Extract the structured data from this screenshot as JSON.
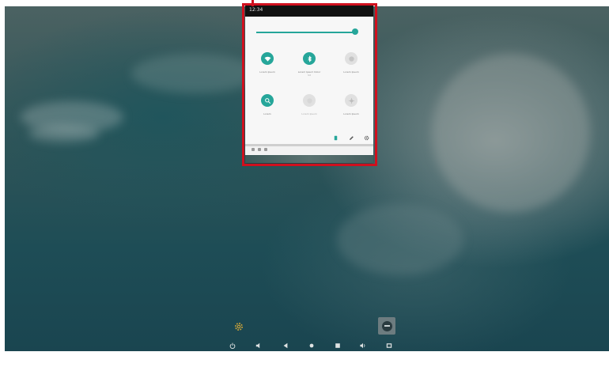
{
  "quick_settings": {
    "status_time": "12:34",
    "brightness_level": 0.95,
    "tiles": [
      {
        "label": "Lorem Ipsum",
        "sub": "",
        "state": "on",
        "icon": "wifi-icon"
      },
      {
        "label": "Lorem Ipsum Dolor",
        "sub": "Sit",
        "state": "on",
        "icon": "bluetooth-icon"
      },
      {
        "label": "Lorem Ipsum",
        "sub": "",
        "state": "off",
        "icon": "do-not-disturb-icon"
      },
      {
        "label": "Lorem",
        "sub": "",
        "state": "on",
        "icon": "location-icon"
      },
      {
        "label": "",
        "sub": "Lorem Ipsum",
        "state": "off",
        "icon": "airplane-mode-icon"
      },
      {
        "label": "Lorem Ipsum",
        "sub": "",
        "state": "off",
        "icon": "rotate-icon"
      }
    ],
    "footer_icons": [
      "page-indicator-icon",
      "edit-icon",
      "settings-icon"
    ]
  },
  "home": {
    "shortcuts": [
      "settings-gear-icon",
      "app-launcher-icon"
    ]
  },
  "navbar": {
    "buttons": [
      "power-icon",
      "volume-down-icon",
      "back-icon",
      "home-icon",
      "recents-icon",
      "volume-up-icon",
      "screenshot-icon"
    ]
  },
  "colors": {
    "accent": "#26a69a",
    "highlight_border": "#d0101e",
    "status_bar": "#111111"
  }
}
